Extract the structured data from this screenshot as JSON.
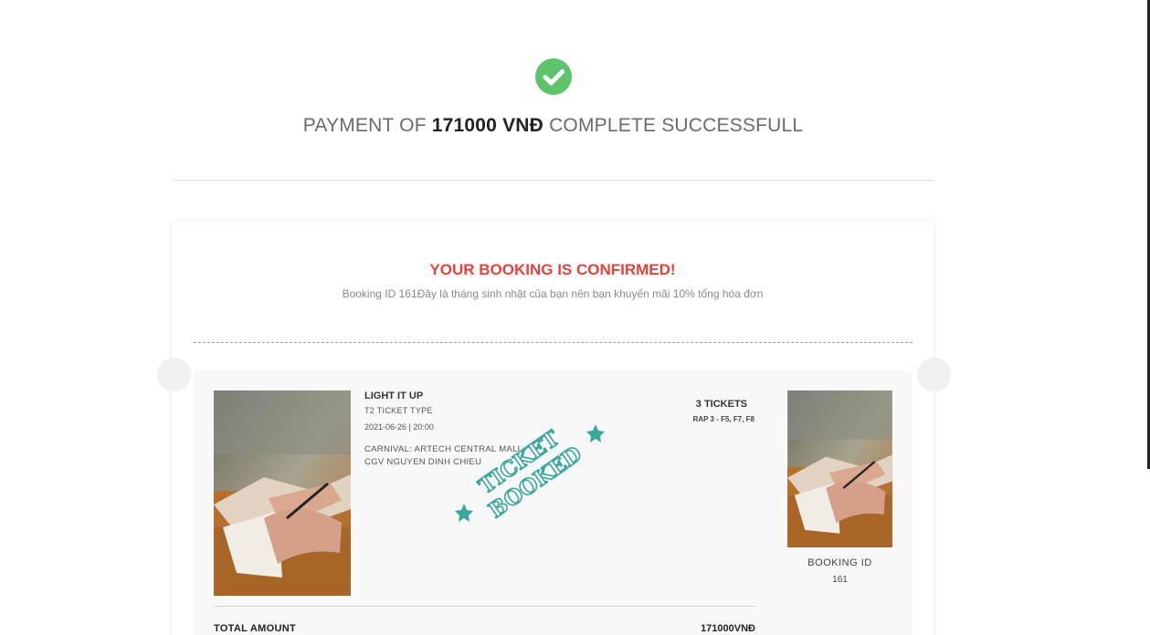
{
  "header": {
    "payment_prefix": "PAYMENT OF",
    "payment_amount": "171000 VNĐ",
    "payment_suffix": "COMPLETE SUCCESSFULL",
    "check_icon": "check-circle-icon",
    "accent_color": "#5cc46a"
  },
  "confirmation": {
    "title": "YOUR BOOKING IS CONFIRMED!",
    "title_color": "#e8413c",
    "note": "Booking ID 161Đây là tháng sinh nhật của bạn nên bạn khuyến mãi 10% tổng hóa đơn"
  },
  "ticket": {
    "movie_title": "LIGHT IT UP",
    "ticket_type": "T2 TICKET TYPE",
    "show_datetime": "2021-06-26 | 20:00",
    "cinema_line1": "CARNIVAL: ARTECH CENTRAL MALL",
    "cinema_line2": "CGV NGUYEN DINH CHIEU",
    "ticket_count": "3 TICKETS",
    "seat_info": "RAP 3 - F5, F7, F8",
    "stamp_line1": "TICKET",
    "stamp_line2": "BOOKED",
    "stamp_color": "#3aa89c",
    "booking_id_label": "BOOKING ID",
    "booking_id_value": "161"
  },
  "totals": {
    "label": "TOTAL AMOUNT",
    "value": "171000VNĐ"
  }
}
